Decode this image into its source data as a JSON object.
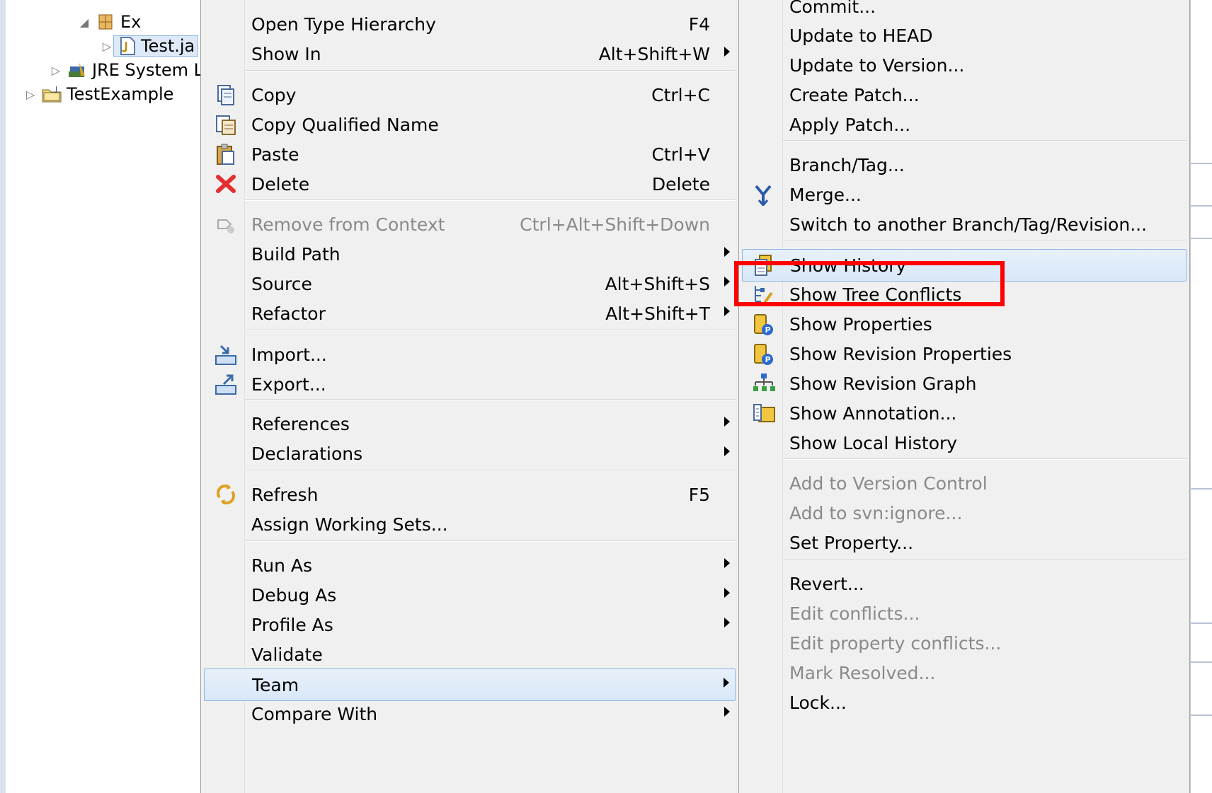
{
  "tree": {
    "items": [
      {
        "label": "Ex",
        "icon": "package-icon"
      },
      {
        "label": "Test.ja",
        "icon": "java-file-icon"
      },
      {
        "label": "JRE System L",
        "icon": "library-icon"
      },
      {
        "label": "TestExample",
        "icon": "java-project-icon"
      }
    ]
  },
  "menu1": {
    "items": [
      {
        "label": "Open Type Hierarchy",
        "shortcut": "F4"
      },
      {
        "label": "Show In",
        "shortcut": "Alt+Shift+W"
      },
      {
        "label": "Copy",
        "shortcut": "Ctrl+C",
        "icon": "copy-icon"
      },
      {
        "label": "Copy Qualified Name",
        "shortcut": "",
        "icon": "copy-qualified-name-icon"
      },
      {
        "label": "Paste",
        "shortcut": "Ctrl+V",
        "icon": "paste-icon"
      },
      {
        "label": "Delete",
        "shortcut": "Delete",
        "icon": "delete-icon"
      },
      {
        "label": "Remove from Context",
        "shortcut": "Ctrl+Alt+Shift+Down",
        "icon": "remove-context-icon",
        "disabled": true
      },
      {
        "label": "Build Path",
        "shortcut": ""
      },
      {
        "label": "Source",
        "shortcut": "Alt+Shift+S"
      },
      {
        "label": "Refactor",
        "shortcut": "Alt+Shift+T"
      },
      {
        "label": "Import...",
        "shortcut": "",
        "icon": "import-icon"
      },
      {
        "label": "Export...",
        "shortcut": "",
        "icon": "export-icon"
      },
      {
        "label": "References",
        "shortcut": ""
      },
      {
        "label": "Declarations",
        "shortcut": ""
      },
      {
        "label": "Refresh",
        "shortcut": "F5",
        "icon": "refresh-icon"
      },
      {
        "label": "Assign Working Sets...",
        "shortcut": ""
      },
      {
        "label": "Run As",
        "shortcut": ""
      },
      {
        "label": "Debug As",
        "shortcut": ""
      },
      {
        "label": "Profile As",
        "shortcut": ""
      },
      {
        "label": "Validate",
        "shortcut": ""
      },
      {
        "label": "Team",
        "shortcut": "",
        "highlighted": true
      },
      {
        "label": "Compare With",
        "shortcut": ""
      }
    ]
  },
  "menu2": {
    "items": [
      {
        "label": "Commit..."
      },
      {
        "label": "Update to HEAD"
      },
      {
        "label": "Update to Version..."
      },
      {
        "label": "Create Patch..."
      },
      {
        "label": "Apply Patch..."
      },
      {
        "label": "Branch/Tag..."
      },
      {
        "label": "Merge...",
        "icon": "merge-icon"
      },
      {
        "label": "Switch to another Branch/Tag/Revision..."
      },
      {
        "label": "Show History",
        "icon": "history-icon",
        "highlighted": true
      },
      {
        "label": "Show Tree Conflicts",
        "icon": "tree-conflicts-icon"
      },
      {
        "label": "Show Properties",
        "icon": "properties-icon"
      },
      {
        "label": "Show Revision Properties",
        "icon": "revision-properties-icon"
      },
      {
        "label": "Show Revision Graph",
        "icon": "revision-graph-icon"
      },
      {
        "label": "Show Annotation...",
        "icon": "annotation-icon"
      },
      {
        "label": "Show Local History"
      },
      {
        "label": "Add to Version Control",
        "disabled": true
      },
      {
        "label": "Add to svn:ignore...",
        "disabled": true
      },
      {
        "label": "Set Property..."
      },
      {
        "label": "Revert..."
      },
      {
        "label": "Edit conflicts...",
        "disabled": true
      },
      {
        "label": "Edit property conflicts...",
        "disabled": true
      },
      {
        "label": "Mark Resolved...",
        "disabled": true
      },
      {
        "label": "Lock..."
      }
    ]
  },
  "colors": {
    "menu_bg": "#f0f0f0",
    "highlight_bg": "#dde9f8",
    "highlight_border": "#8fb6e3",
    "annotation_box": "#ff0000",
    "disabled_text": "#8a8a8a"
  }
}
